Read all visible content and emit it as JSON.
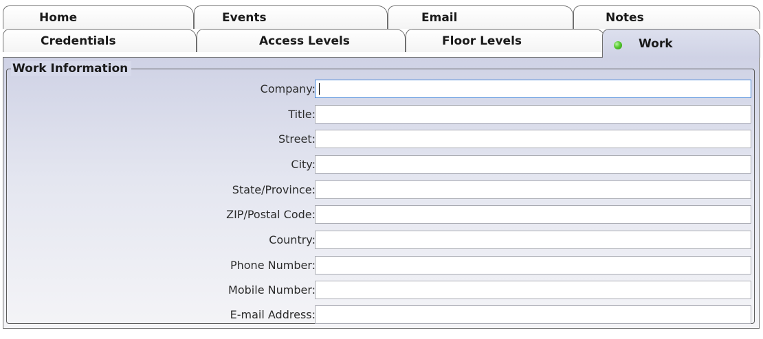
{
  "tabs_row1": [
    {
      "label": "Home"
    },
    {
      "label": "Events"
    },
    {
      "label": "Email"
    },
    {
      "label": "Notes"
    }
  ],
  "tabs_row2": [
    {
      "label": "Credentials"
    },
    {
      "label": "Access Levels"
    },
    {
      "label": "Floor Levels"
    },
    {
      "label": "Work",
      "selected": true,
      "status": "green-dot-icon"
    }
  ],
  "group": {
    "title": "Work Information"
  },
  "fields": [
    {
      "label": "Company:",
      "value": ""
    },
    {
      "label": "Title:",
      "value": ""
    },
    {
      "label": "Street:",
      "value": ""
    },
    {
      "label": "City:",
      "value": ""
    },
    {
      "label": "State/Province:",
      "value": ""
    },
    {
      "label": "ZIP/Postal Code:",
      "value": ""
    },
    {
      "label": "Country:",
      "value": ""
    },
    {
      "label": "Phone Number:",
      "value": ""
    },
    {
      "label": "Mobile Number:",
      "value": ""
    },
    {
      "label": "E-mail Address:",
      "value": ""
    }
  ],
  "colors": {
    "panel": "#cfd2e5",
    "focus_border": "#3c7fd6",
    "status_dot": "#56c92f"
  }
}
